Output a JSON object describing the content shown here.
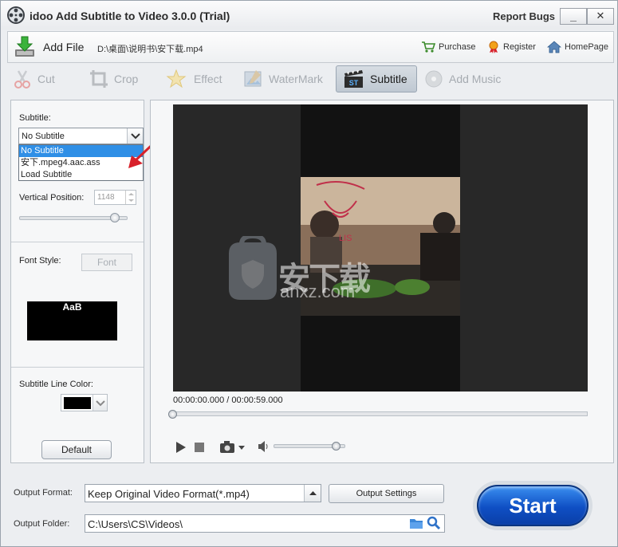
{
  "window": {
    "title": "idoo Add Subtitle to Video 3.0.0 (Trial)",
    "report_bugs": "Report Bugs",
    "minimize": "_",
    "close": "✕"
  },
  "topbar": {
    "add_file": "Add File",
    "file_path": "D:\\桌面\\说明书\\安下载.mp4",
    "purchase": "Purchase",
    "register": "Register",
    "homepage": "HomePage"
  },
  "tools": [
    {
      "label": "Cut",
      "icon": "scissors-icon",
      "active": false
    },
    {
      "label": "Crop",
      "icon": "crop-icon",
      "active": false
    },
    {
      "label": "Effect",
      "icon": "star-icon",
      "active": false
    },
    {
      "label": "WaterMark",
      "icon": "watermark-icon",
      "active": false
    },
    {
      "label": "Subtitle",
      "icon": "clapboard-icon",
      "active": true
    },
    {
      "label": "Add Music",
      "icon": "music-disc-icon",
      "active": false
    }
  ],
  "left": {
    "subtitle_label": "Subtitle:",
    "subtitle_selected": "No Subtitle",
    "subtitle_options": [
      "No Subtitle",
      "安下.mpeg4.aac.ass",
      "Load Subtitle"
    ],
    "vertical_label": "Vertical Position:",
    "vertical_value": "1148",
    "vertical_slider_level": 0.88,
    "font_style_label": "Font Style:",
    "font_button": "Font",
    "font_preview": "AaB",
    "line_color_label": "Subtitle Line Color:",
    "line_color": "#000000",
    "default_button": "Default"
  },
  "player": {
    "time": "00:00:00.000 / 00:00:59.000",
    "volume_level": 0.88,
    "seek_level": 0.0
  },
  "bottom": {
    "output_format_label": "Output Format:",
    "output_format_value": "Keep Original Video Format(*.mp4)",
    "output_settings": "Output Settings",
    "output_folder_label": "Output Folder:",
    "output_folder_value": "C:\\Users\\CS\\Videos\\",
    "start": "Start"
  },
  "watermark": {
    "text": "安下载",
    "sub": "anxz.com"
  },
  "colors": {
    "accent": "#2f8fe6",
    "start_blue": "#0f4fc4",
    "arrow_red": "#d8212a"
  }
}
